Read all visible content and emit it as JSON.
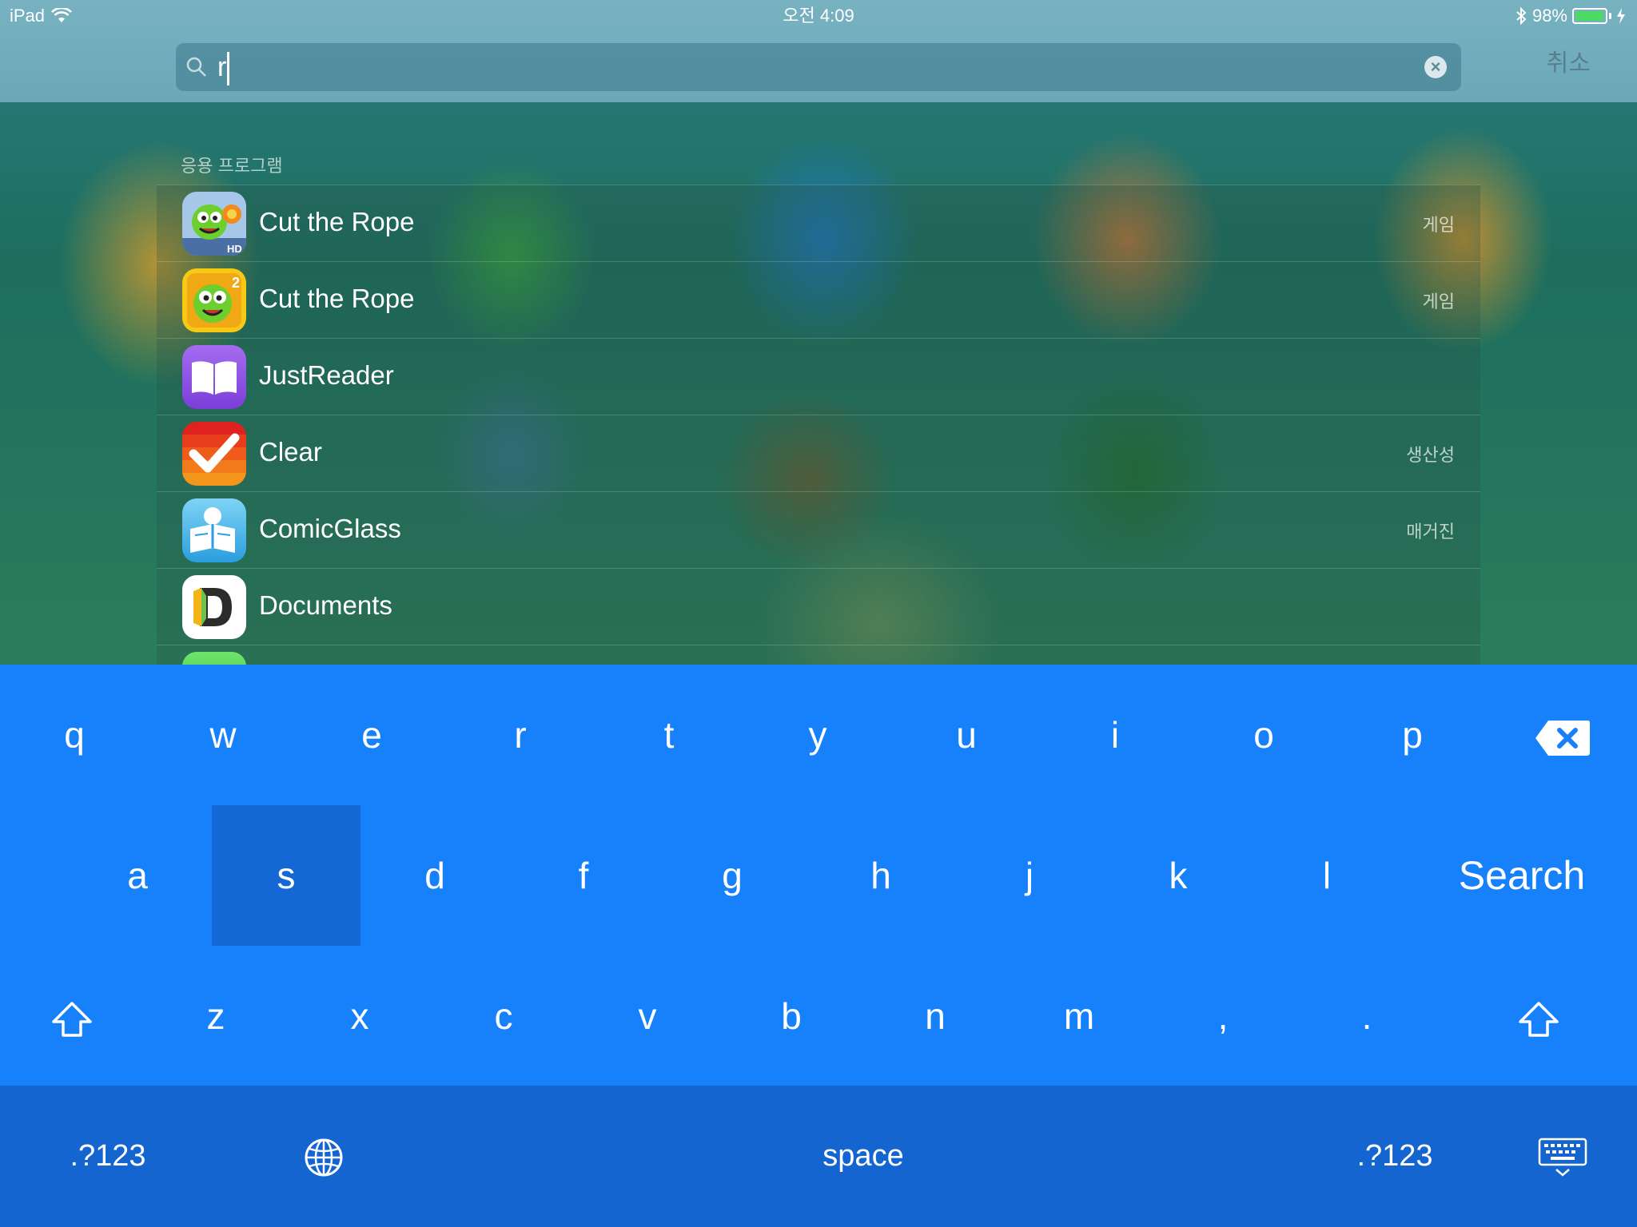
{
  "status_bar": {
    "device": "iPad",
    "time": "오전 4:09",
    "battery": "98%",
    "battery_level": 0.98
  },
  "search": {
    "query": "r",
    "cancel_label": "취소"
  },
  "results": {
    "section_title": "응용 프로그램",
    "items": [
      {
        "name": "Cut the Rope",
        "category": "게임",
        "icon": "cut-the-rope-hd-icon"
      },
      {
        "name": "Cut the Rope",
        "category": "게임",
        "icon": "cut-the-rope-2-icon"
      },
      {
        "name": "JustReader",
        "category": "",
        "icon": "justreader-icon"
      },
      {
        "name": "Clear",
        "category": "생산성",
        "icon": "clear-icon"
      },
      {
        "name": "ComicGlass",
        "category": "매거진",
        "icon": "comicglass-icon"
      },
      {
        "name": "Documents",
        "category": "",
        "icon": "documents-icon"
      }
    ]
  },
  "keyboard": {
    "row1": [
      "q",
      "w",
      "e",
      "r",
      "t",
      "y",
      "u",
      "i",
      "o",
      "p"
    ],
    "row2": [
      "a",
      "s",
      "d",
      "f",
      "g",
      "h",
      "j",
      "k",
      "l"
    ],
    "row3": [
      "z",
      "x",
      "c",
      "v",
      "b",
      "n",
      "m",
      ",",
      "."
    ],
    "search_label": "Search",
    "space_label": "space",
    "numbers_label": ".?123",
    "pressed_key": "s",
    "accent_color": "#1681fb"
  }
}
